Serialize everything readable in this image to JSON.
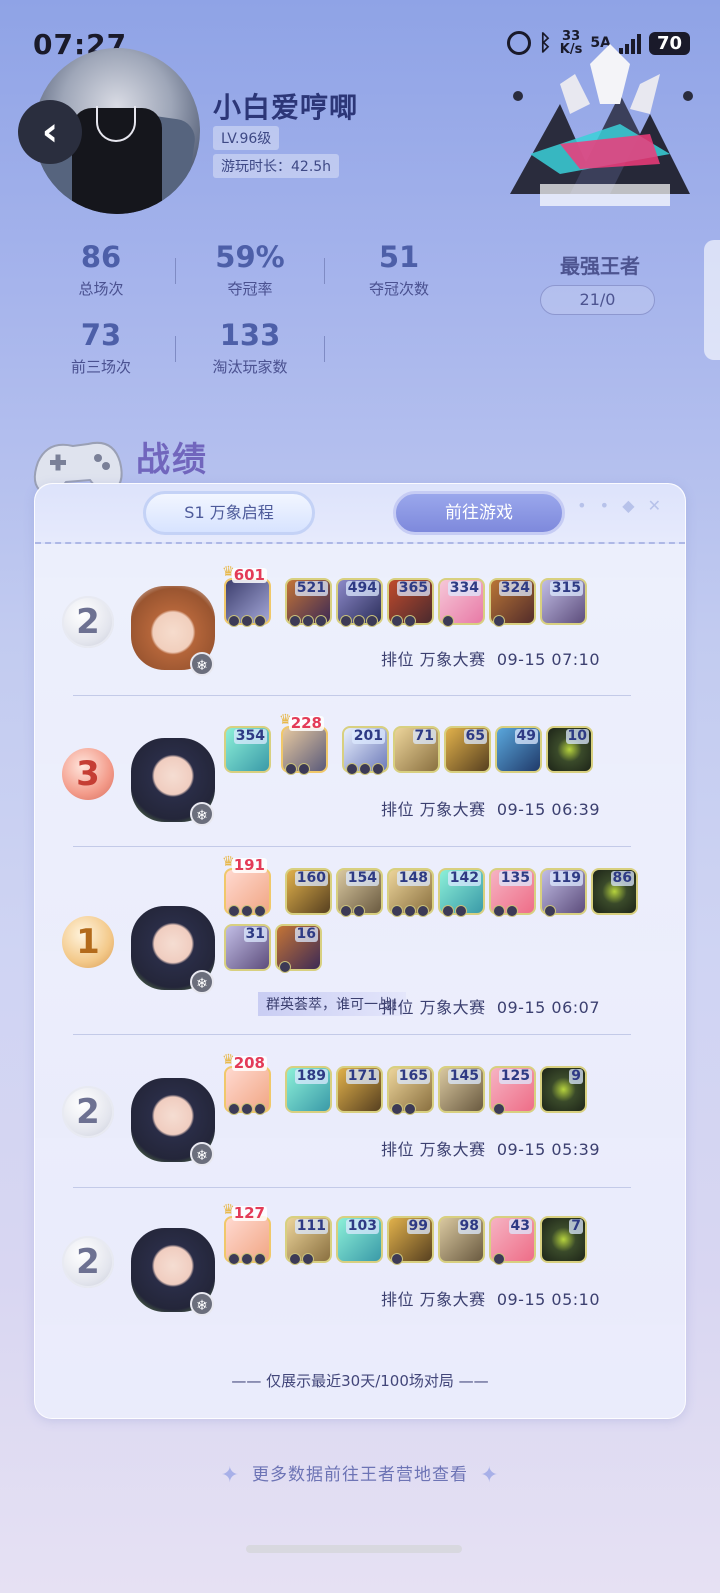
{
  "status_bar": {
    "time": "07:27",
    "speed_value": "33",
    "speed_unit": "K/s",
    "network": "5A",
    "battery": "70"
  },
  "profile": {
    "name": "小白爱哼唧",
    "level": "LV.96级",
    "playtime": "游玩时长：42.5h"
  },
  "stats": [
    {
      "value": "86",
      "label": "总场次"
    },
    {
      "value": "59%",
      "label": "夺冠率"
    },
    {
      "value": "51",
      "label": "夺冠次数"
    },
    {
      "value": "73",
      "label": "前三场次"
    },
    {
      "value": "133",
      "label": "淘汰玩家数"
    }
  ],
  "rank": {
    "title": "最强王者",
    "record": "21/0"
  },
  "section": {
    "title": "战绩"
  },
  "card": {
    "season_label": "S1 万象启程",
    "go_label": "前往游戏"
  },
  "matches": [
    {
      "place": "2",
      "hero_scores": [
        "601",
        "521",
        "494",
        "365",
        "334",
        "324",
        "315"
      ],
      "extra_scores": [],
      "mode": "排位 万象大赛",
      "time": "09-15 07:10",
      "taunt": ""
    },
    {
      "place": "3",
      "hero_scores": [
        "354",
        "228",
        "201",
        "71",
        "65",
        "49",
        "10"
      ],
      "extra_scores": [],
      "mode": "排位 万象大赛",
      "time": "09-15 06:39",
      "taunt": ""
    },
    {
      "place": "1",
      "hero_scores": [
        "191",
        "160",
        "154",
        "148",
        "142",
        "135",
        "119",
        "86"
      ],
      "extra_scores": [
        "31",
        "16"
      ],
      "mode": "排位 万象大赛",
      "time": "09-15 06:07",
      "taunt": "群英荟萃，谁可一战!"
    },
    {
      "place": "2",
      "hero_scores": [
        "208",
        "189",
        "171",
        "165",
        "145",
        "125",
        "9"
      ],
      "extra_scores": [],
      "mode": "排位 万象大赛",
      "time": "09-15 05:39",
      "taunt": ""
    },
    {
      "place": "2",
      "hero_scores": [
        "127",
        "111",
        "103",
        "99",
        "98",
        "43",
        "7"
      ],
      "extra_scores": [],
      "mode": "排位 万象大赛",
      "time": "09-15 05:10",
      "taunt": ""
    }
  ],
  "footer": {
    "note": "—— 仅展示最近30天/100场对局 ——",
    "more": "更多数据前往王者营地查看"
  }
}
